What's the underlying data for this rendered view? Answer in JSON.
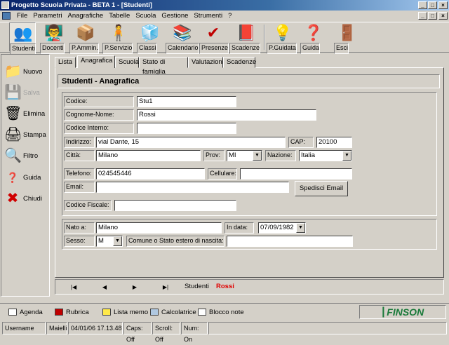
{
  "window": {
    "title": "Progetto Scuola Privata - BETA 1 - [Studenti]",
    "min": "_",
    "max": "□",
    "close": "×"
  },
  "menu": [
    "File",
    "Parametri",
    "Anagrafiche",
    "Tabelle",
    "Scuola",
    "Gestione",
    "Strumenti",
    "?"
  ],
  "toolbar": [
    {
      "label": "Studenti",
      "icon": "students-icon",
      "glyph": "👥"
    },
    {
      "label": "Docenti",
      "icon": "teachers-icon",
      "glyph": "👨‍🏫"
    },
    {
      "label": "P.Ammin.",
      "icon": "admin-staff-icon",
      "glyph": "📦"
    },
    {
      "label": "P.Servizio",
      "icon": "service-staff-icon",
      "glyph": "🧍"
    },
    {
      "label": "Classi",
      "icon": "classes-icon",
      "glyph": "🧊"
    },
    {
      "label": "Calendario",
      "icon": "calendar-icon",
      "glyph": "📚"
    },
    {
      "label": "Presenze",
      "icon": "attendance-icon",
      "glyph": "✔"
    },
    {
      "label": "Scadenze",
      "icon": "deadlines-icon",
      "glyph": "📕"
    },
    {
      "label": "P.Guidata",
      "icon": "lightbulb-icon",
      "glyph": "💡"
    },
    {
      "label": "Guida",
      "icon": "help-icon",
      "glyph": "❓"
    },
    {
      "label": "Esci",
      "icon": "exit-icon",
      "glyph": "🚪"
    }
  ],
  "sidebar": [
    {
      "label": "Nuovo",
      "icon": "new-folder-icon",
      "glyph": "📁"
    },
    {
      "label": "Salva",
      "icon": "save-icon",
      "glyph": "💾"
    },
    {
      "label": "Elimina",
      "icon": "trash-icon",
      "glyph": "🗑"
    },
    {
      "label": "Stampa",
      "icon": "printer-icon",
      "glyph": "🖨"
    },
    {
      "label": "Filtro",
      "icon": "filter-icon",
      "glyph": "🔍"
    },
    {
      "label": "Guida",
      "icon": "help-icon",
      "glyph": "❓"
    },
    {
      "label": "Chiudi",
      "icon": "close-icon",
      "glyph": "✖"
    }
  ],
  "tabs": [
    "Lista",
    "Anagrafica",
    "Scuola",
    "Stato di famiglia",
    "Valutazioni",
    "Scadenze"
  ],
  "header": "Studenti - Anagrafica",
  "form": {
    "codice_label": "Codice:",
    "codice": "Stu1",
    "nome_label": "Cognome-Nome:",
    "nome": "Rossi",
    "interno_label": "Codice Interno:",
    "interno": "",
    "indirizzo_label": "Indirizzo:",
    "indirizzo": "vial Dante, 15",
    "cap_label": "CAP:",
    "cap": "20100",
    "citta_label": "Città:",
    "citta": "Milano",
    "prov_label": "Prov:",
    "prov": "MI",
    "nazione_label": "Nazione:",
    "nazione": "Italia",
    "tel_label": "Telefono:",
    "tel": "024545446",
    "cell_label": "Cellulare:",
    "cell": "",
    "email_label": "Email:",
    "email": "",
    "send_email": "Spedisci Email",
    "cf_label": "Codice Fiscale:",
    "cf": "",
    "nato_label": "Nato a:",
    "nato": "Milano",
    "data_label": "In data:",
    "data": "07/09/1982",
    "sesso_label": "Sesso:",
    "sesso": "M",
    "comune_label": "Comune o Stato estero di nascita:",
    "comune": ""
  },
  "nav": {
    "first": "|◀",
    "prev": "◀",
    "next": "▶",
    "last": "▶|",
    "entity": "Studenti",
    "current": "Rossi",
    "current_color": "#e00000"
  },
  "bottom": [
    {
      "label": "Agenda",
      "icon": "agenda-icon"
    },
    {
      "label": "Rubrica",
      "icon": "contacts-icon"
    },
    {
      "label": "Lista memo",
      "icon": "memo-icon"
    },
    {
      "label": "Calcolatrice",
      "icon": "calculator-icon"
    },
    {
      "label": "Blocco note",
      "icon": "notepad-icon"
    }
  ],
  "logo": "FINSON",
  "status": [
    "Username",
    "Maielli",
    "04/01/06 17.13.48",
    "Caps: Off",
    "Scroll: Off",
    "Num: On"
  ]
}
